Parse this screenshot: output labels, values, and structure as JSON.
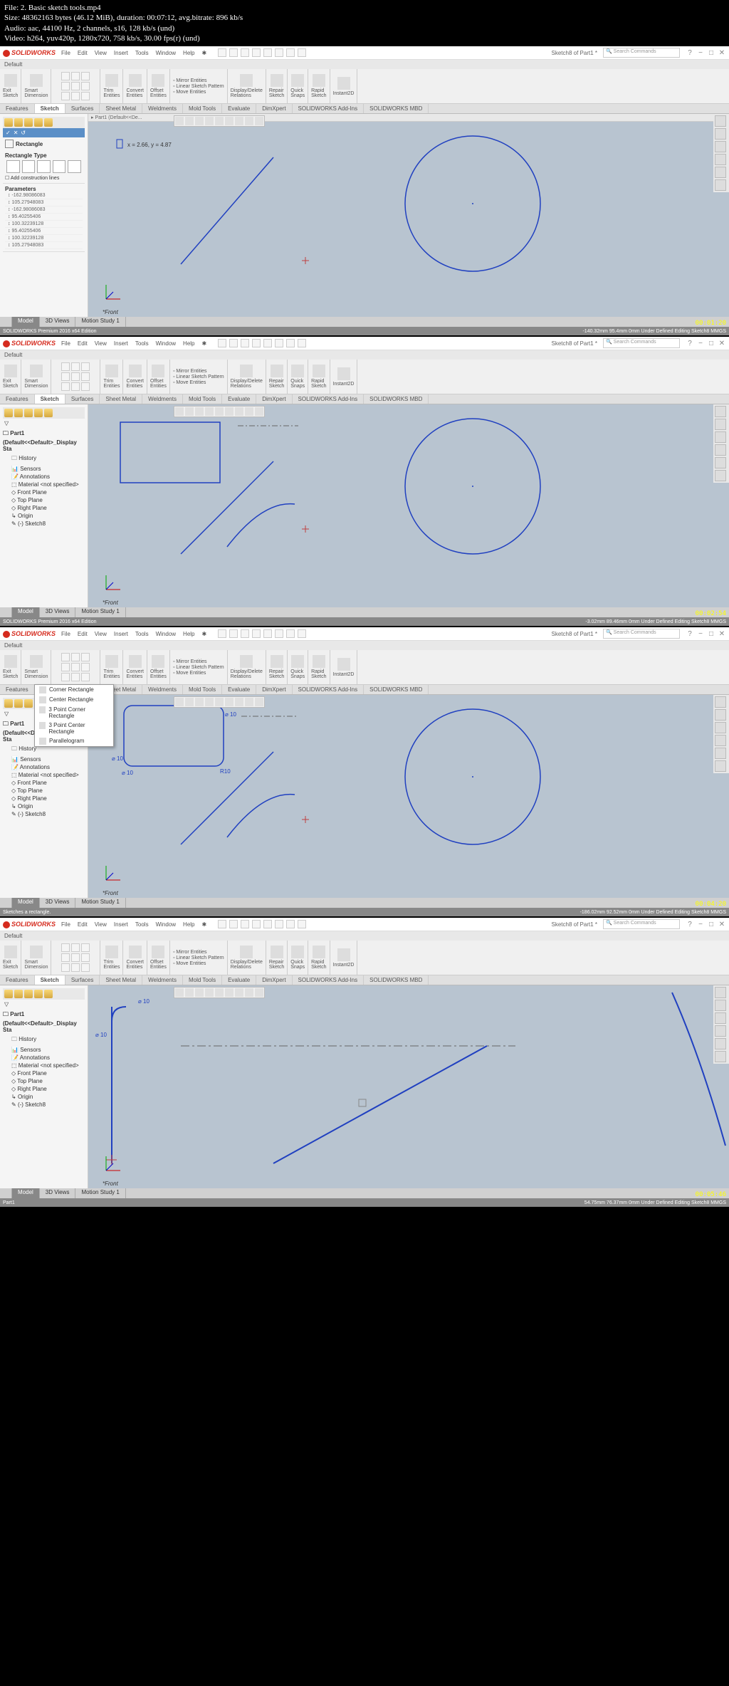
{
  "fileinfo": {
    "file": "File: 2. Basic sketch tools.mp4",
    "size": "Size: 48362163 bytes (46.12 MiB), duration: 00:07:12, avg.bitrate: 896 kb/s",
    "audio": "Audio: aac, 44100 Hz, 2 channels, s16, 128 kb/s (und)",
    "video": "Video: h264, yuv420p, 1280x720, 758 kb/s, 30.00 fps(r) (und)"
  },
  "app": {
    "name": "SOLIDWORKS",
    "menus": [
      "File",
      "Edit",
      "View",
      "Insert",
      "Tools",
      "Window",
      "Help"
    ],
    "doc_title": "Sketch8 of Part1 *",
    "search_placeholder": "Search Commands",
    "default": "Default"
  },
  "ribbon": {
    "exit_sketch": "Exit\nSketch",
    "smart_dim": "Smart\nDimension",
    "trim": "Trim\nEntities",
    "convert": "Convert\nEntities",
    "offset": "Offset\nEntities",
    "mirror": "Mirror Entities",
    "linear_pattern": "Linear Sketch Pattern",
    "move": "Move Entities",
    "display": "Display/Delete\nRelations",
    "repair": "Repair\nSketch",
    "quick": "Quick\nSnaps",
    "rapid": "Rapid\nSketch",
    "instant": "Instant2D"
  },
  "tabs": [
    "Features",
    "Sketch",
    "Surfaces",
    "Sheet Metal",
    "Weldments",
    "Mold Tools",
    "Evaluate",
    "DimXpert",
    "SOLIDWORKS Add-Ins",
    "SOLIDWORKS MBD"
  ],
  "rect_panel": {
    "title": "Rectangle",
    "type_label": "Rectangle Type",
    "add_construction": "Add construction lines",
    "params_label": "Parameters",
    "params": [
      "-162.98086083",
      "105.27948083",
      "-162.98086083",
      "95.40255406",
      "100.32239128",
      "95.40255406",
      "100.32239128",
      "105.27948083"
    ]
  },
  "coord_text": "x = 2.66, y = 4.87",
  "crumbs": {
    "f1": "Part1 (Default<<De...",
    "front": "*Front"
  },
  "tree": {
    "root": "Part1 (Default<<Default>_Display Sta",
    "items": [
      "History",
      "Sensors",
      "Annotations",
      "Material <not specified>",
      "Front Plane",
      "Top Plane",
      "Right Plane",
      "Origin",
      "(-) Sketch8"
    ]
  },
  "rect_dropdown": [
    "Corner Rectangle",
    "Center Rectangle",
    "3 Point Corner Rectangle",
    "3 Point Center Rectangle",
    "Parallelogram"
  ],
  "bottom_tabs": [
    "Model",
    "3D Views",
    "Motion Study 1"
  ],
  "status": {
    "edition": "SOLIDWORKS Premium 2016 x64 Edition",
    "sketch_rect": "Sketches a rectangle.",
    "part": "Part1",
    "f1": "-140.32mm   95.4mm   0mm   Under Defined   Editing Sketch8   MMGS",
    "f2": "-3.02mm   89.46mm   0mm   Under Defined   Editing Sketch8   MMGS",
    "f3": "-186.02mm   92.52mm   0mm   Under Defined   Editing Sketch8   MMGS",
    "f4": "54.75mm   76.37mm   0mm   Under Defined   Editing Sketch8   MMGS"
  },
  "dims": {
    "d10": "10",
    "r10": "R10"
  },
  "timestamps": [
    "00:01:20",
    "00:02:54",
    "00:04:20",
    "00:05:46"
  ]
}
